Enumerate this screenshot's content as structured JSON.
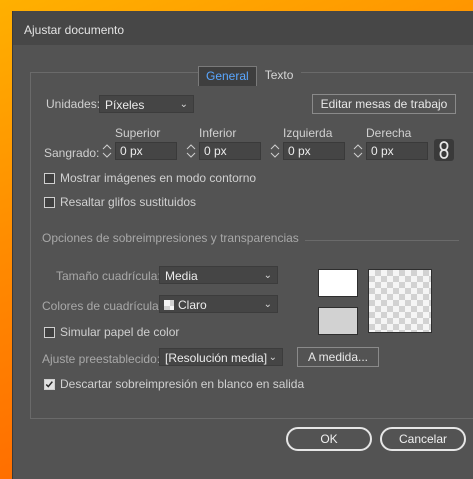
{
  "window": {
    "title": "Ajustar documento"
  },
  "tabs": [
    {
      "label": "General",
      "active": true
    },
    {
      "label": "Texto",
      "active": false
    }
  ],
  "units": {
    "label": "Unidades:",
    "value": "Píxeles"
  },
  "edit_artboards_button": "Editar mesas de trabajo",
  "bleed": {
    "label": "Sangrado:",
    "fields": [
      {
        "label": "Superior",
        "value": "0 px"
      },
      {
        "label": "Inferior",
        "value": "0 px"
      },
      {
        "label": "Izquierda",
        "value": "0 px"
      },
      {
        "label": "Derecha",
        "value": "0 px"
      }
    ],
    "link_icon": "chain-link-icon"
  },
  "checkboxes": {
    "outline": {
      "label": "Mostrar imágenes en modo contorno",
      "checked": false
    },
    "glyphs": {
      "label": "Resaltar glifos sustituidos",
      "checked": false
    },
    "paper": {
      "label": "Simular papel de color",
      "checked": false
    },
    "discard": {
      "label": "Descartar sobreimpresión en blanco en salida",
      "checked": true
    }
  },
  "section_title": "Opciones de sobreimpresiones y transparencias",
  "grid_size": {
    "label": "Tamaño cuadrícula:",
    "value": "Media"
  },
  "grid_colors": {
    "label": "Colores de cuadrícula:",
    "value": "Claro"
  },
  "preset": {
    "label": "Ajuste preestablecido:",
    "value": "[Resolución media]",
    "custom_button": "A medida..."
  },
  "buttons": {
    "ok": "OK",
    "cancel": "Cancelar"
  },
  "colors": {
    "accent": "#5aa7ff",
    "dialog_bg": "#535353",
    "title_bg": "#474747",
    "frame": "#ff8a00"
  }
}
